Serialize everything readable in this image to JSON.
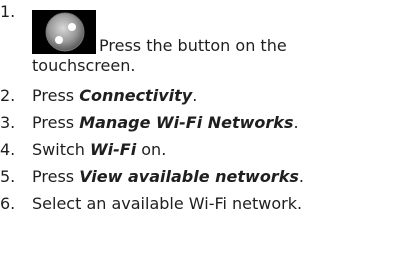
{
  "steps": [
    {
      "number": "1.",
      "text": "Press the button on the",
      "text2": "touchscreen.",
      "icon": "settings-round-button-icon"
    },
    {
      "number": "2.",
      "text": "Press ",
      "bold": "Connectivity",
      "suffix": "."
    },
    {
      "number": "3.",
      "text": "Press ",
      "bold": "Manage Wi-Fi Networks",
      "suffix": "."
    },
    {
      "number": "4.",
      "text": "Switch ",
      "bold": "Wi-Fi",
      "suffix": " on."
    },
    {
      "number": "5.",
      "text": "Press ",
      "bold": "View available networks",
      "suffix": "."
    },
    {
      "number": "6.",
      "text": "Select an available Wi-Fi network."
    }
  ]
}
